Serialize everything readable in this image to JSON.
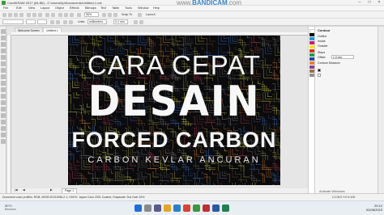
{
  "app": {
    "title": "CorelDRAW 2017 (64-Bit) - C:\\Users\\hp\\Documents\\Untitled-1.cdr",
    "watermark_prefix": "www.",
    "watermark_brand": "BANDICAM",
    "watermark_suffix": ".com"
  },
  "menu": [
    "File",
    "Edit",
    "View",
    "Layout",
    "Object",
    "Effects",
    "Bitmaps",
    "Text",
    "Table",
    "Tools",
    "Window",
    "Help"
  ],
  "toolbar": {
    "zoom": "56%",
    "snap_to": "Snap To",
    "launch": "Launch",
    "units": "millimeters",
    "nudge": "0.1 mm"
  },
  "tabs": [
    {
      "label": "Welcome Screen"
    },
    {
      "label": "Untitled-1"
    }
  ],
  "artwork": {
    "line1": "CARA CEPAT",
    "line2": "DESAIN",
    "line3": "FORCED CARBON",
    "line4": "CARBON KEVLAR ANCURAN",
    "bg_color": "#0b0b0d",
    "pattern_colors": [
      "#8a8a3a",
      "#b06a2a",
      "#3b6ab0",
      "#a03a4a",
      "#6a6a6a",
      "#c0c040"
    ]
  },
  "page_nav": {
    "page_label": "Page 1"
  },
  "docker": {
    "title": "Contour",
    "options": [
      "Outline",
      "Inside",
      "Outside"
    ],
    "steps_label": "Steps",
    "offset_label": "Offset",
    "offset_value": "1.0 mm",
    "distance_label": "Contour Distance"
  },
  "activate": {
    "line1": "Activate Windows",
    "line2": "Go to Settings to activate Windows."
  },
  "statusbar": {
    "text": "Document color profiles: RGB: sRGB IEC61966-2.1; CMYK: Japan Color 2001 Coated; Grayscale: Dot Gain 15%",
    "right": "C:0 M:0 Y:0 K:100"
  },
  "taskbar": {
    "temp": "30°C",
    "weather": "Berawan",
    "time": "20:12",
    "date": "02/08/2023"
  }
}
